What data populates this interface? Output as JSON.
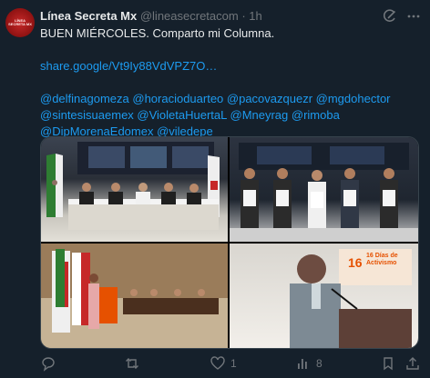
{
  "account": {
    "avatar_text": "LÍNEA SECRETA MX",
    "display_name": "Línea Secreta Mx",
    "handle": "@lineasecretacom",
    "separator": "·",
    "time": "1h"
  },
  "tweet": {
    "line1": "BUEN MIÉRCOLES. Comparto mi Columna.",
    "link": "share.google/Vt9Iy88VdVPZ7O…",
    "mentions_line1": "@delfinagomeza @horacioduarteo @pacovazquezr @mgdohector",
    "mentions_line2": "@sintesisuaemex @VioletaHuertaL @Mneyrag @rimoba",
    "mentions_line3": "@DipMorenaEdomex @viledepe"
  },
  "media": {
    "photo4_banner_text": "16 Días de Activismo"
  },
  "actions": {
    "reply_count": "",
    "retweet_count": "",
    "like_count": "1",
    "views_count": "8"
  },
  "icons": [
    "grok-icon",
    "more-icon",
    "reply-icon",
    "retweet-icon",
    "like-icon",
    "views-icon",
    "bookmark-icon",
    "share-icon"
  ],
  "colors": {
    "background": "#15202b",
    "link": "#1d9bf0",
    "muted": "#71767b",
    "text": "#e7e9ea"
  }
}
